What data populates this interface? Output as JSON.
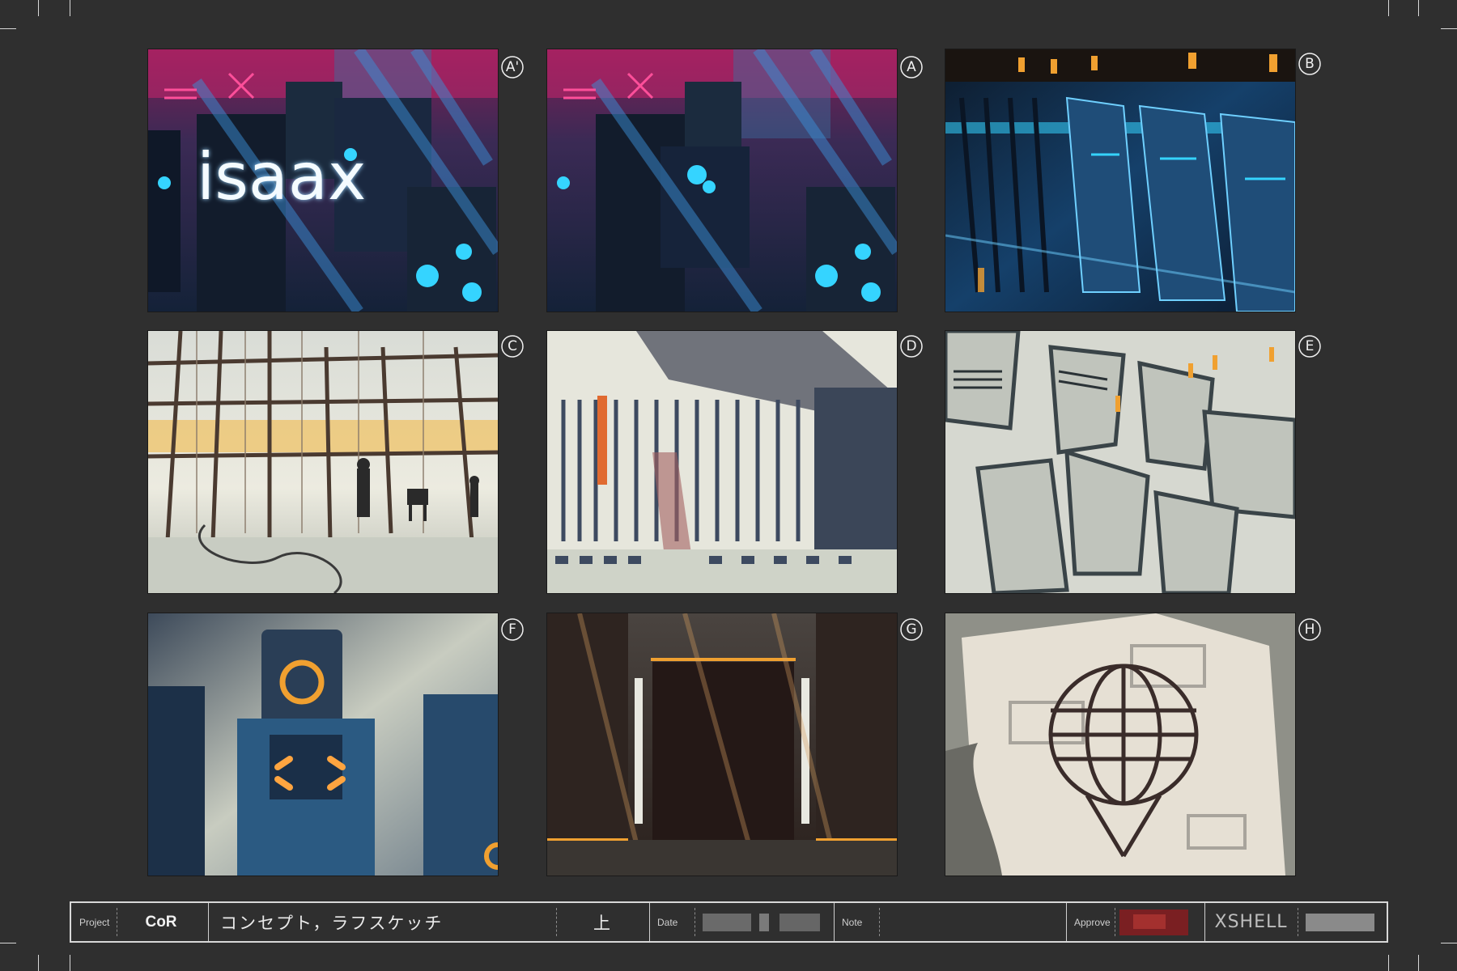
{
  "panels": [
    {
      "id": "A-prime",
      "label": "A'",
      "logo": "isaax"
    },
    {
      "id": "A",
      "label": "A"
    },
    {
      "id": "B",
      "label": "B"
    },
    {
      "id": "C",
      "label": "C"
    },
    {
      "id": "D",
      "label": "D"
    },
    {
      "id": "E",
      "label": "E"
    },
    {
      "id": "F",
      "label": "F"
    },
    {
      "id": "G",
      "label": "G"
    },
    {
      "id": "H",
      "label": "H"
    }
  ],
  "titleblock": {
    "project_label": "Project",
    "project_value": "CoR",
    "description": "コンセプト，ラフスケッチ",
    "part": "上",
    "date_label": "Date",
    "note_label": "Note",
    "approve_label": "Approve",
    "studio_logo": "XSHELL"
  },
  "colors": {
    "background": "#2f2f2f",
    "frame": "#d8d8d8",
    "neon_pink": "#c8246b",
    "neon_cyan": "#35d4ff",
    "warm_orange": "#e8a030"
  }
}
